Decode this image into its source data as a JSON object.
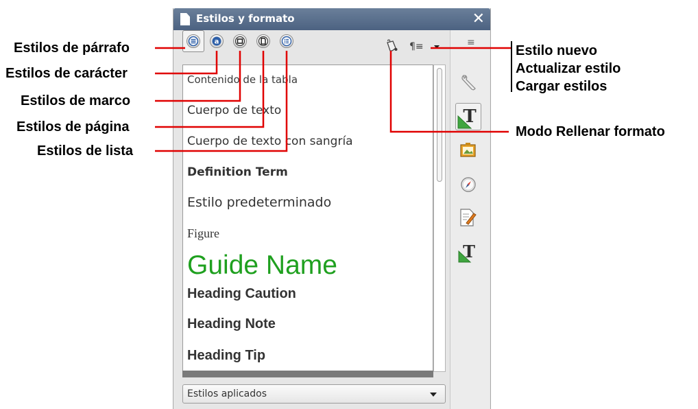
{
  "window": {
    "title": "Estilos y formato",
    "close_glyph": "✕"
  },
  "callouts": {
    "left": [
      "Estilos de párrafo",
      "Estilos de carácter",
      "Estilos de marco",
      "Estilos de página",
      "Estilos de lista"
    ],
    "right": [
      "Estilo nuevo",
      "Actualizar estilo",
      "Cargar estilos",
      "Modo Rellenar formato"
    ]
  },
  "toolbar": {
    "buttons": [
      {
        "name": "paragraph-styles",
        "icon": "paragraph-lines-icon",
        "active": true
      },
      {
        "name": "character-styles",
        "icon": "character-a-icon",
        "active": false
      },
      {
        "name": "frame-styles",
        "icon": "frame-icon",
        "active": false
      },
      {
        "name": "page-styles",
        "icon": "page-icon",
        "active": false
      },
      {
        "name": "list-styles",
        "icon": "list-bullets-icon",
        "active": false
      }
    ],
    "fill_format_icon": "paint-bucket-icon",
    "style_actions_glyph": "¶≡",
    "menu_glyph": "≡"
  },
  "styles_list": {
    "items": [
      {
        "label": "Contenido de la tabla",
        "style": "small"
      },
      {
        "label": "Cuerpo de texto",
        "style": "normal"
      },
      {
        "label": "Cuerpo de texto con sangría",
        "style": "normal"
      },
      {
        "label": "Definition Term",
        "style": "bold"
      },
      {
        "label": "Estilo predeterminado",
        "style": "large"
      },
      {
        "label": "Figure",
        "style": "serif"
      },
      {
        "label": "Guide Name",
        "style": "guide"
      },
      {
        "label": "Heading Caution",
        "style": "heading"
      },
      {
        "label": "Heading Note",
        "style": "heading"
      },
      {
        "label": "Heading Tip",
        "style": "heading"
      }
    ],
    "guide_color": "#1fa01f"
  },
  "filter": {
    "selected": "Estilos aplicados"
  },
  "sidebar": {
    "icons": [
      "properties-wrench-icon",
      "styles-t-icon",
      "gallery-icon",
      "navigator-compass-icon",
      "manage-changes-icon",
      "styles-t-icon"
    ]
  },
  "colors": {
    "callout_line": "#e00000",
    "titlebar": "#56698a"
  }
}
